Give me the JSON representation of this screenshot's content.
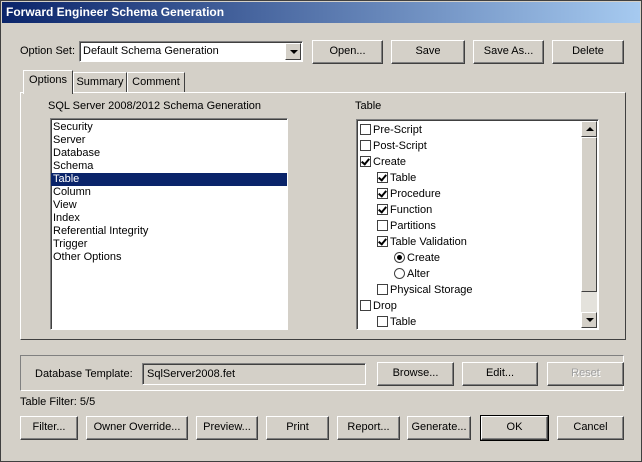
{
  "window": {
    "title": "Forward Engineer Schema Generation"
  },
  "option_set": {
    "label": "Option Set:",
    "value": "Default Schema Generation",
    "buttons": {
      "open": "Open...",
      "save": "Save",
      "save_as": "Save As...",
      "delete": "Delete"
    }
  },
  "tabs": [
    {
      "label": "Options",
      "active": true
    },
    {
      "label": "Summary",
      "active": false
    },
    {
      "label": "Comment",
      "active": false
    }
  ],
  "left_list": {
    "title": "SQL Server 2008/2012 Schema Generation",
    "items": [
      "Security",
      "Server",
      "Database",
      "Schema",
      "Table",
      "Column",
      "View",
      "Index",
      "Referential Integrity",
      "Trigger",
      "Other Options"
    ],
    "selected": "Table"
  },
  "right_list": {
    "title": "Table",
    "items": [
      {
        "label": "Pre-Script",
        "type": "checkbox",
        "checked": false,
        "indent": 0
      },
      {
        "label": "Post-Script",
        "type": "checkbox",
        "checked": false,
        "indent": 0
      },
      {
        "label": "Create",
        "type": "checkbox",
        "checked": true,
        "indent": 0
      },
      {
        "label": "Table",
        "type": "checkbox",
        "checked": true,
        "indent": 1
      },
      {
        "label": "Procedure",
        "type": "checkbox",
        "checked": true,
        "indent": 1
      },
      {
        "label": "Function",
        "type": "checkbox",
        "checked": true,
        "indent": 1
      },
      {
        "label": "Partitions",
        "type": "checkbox",
        "checked": false,
        "indent": 1
      },
      {
        "label": "Table Validation",
        "type": "checkbox",
        "checked": true,
        "indent": 1
      },
      {
        "label": "Create",
        "type": "radio",
        "checked": true,
        "indent": 2
      },
      {
        "label": "Alter",
        "type": "radio",
        "checked": false,
        "indent": 2
      },
      {
        "label": "Physical Storage",
        "type": "checkbox",
        "checked": false,
        "indent": 1
      },
      {
        "label": "Drop",
        "type": "checkbox",
        "checked": false,
        "indent": 0
      },
      {
        "label": "Table",
        "type": "checkbox",
        "checked": false,
        "indent": 1
      }
    ]
  },
  "template": {
    "label": "Database Template:",
    "value": "SqlServer2008.fet",
    "buttons": {
      "browse": "Browse...",
      "edit": "Edit...",
      "reset": "Reset"
    }
  },
  "table_filter": "Table Filter: 5/5",
  "bottom_buttons": {
    "filter": "Filter...",
    "owner_override": "Owner Override...",
    "preview": "Preview...",
    "print": "Print",
    "report": "Report...",
    "generate": "Generate...",
    "ok": "OK",
    "cancel": "Cancel"
  }
}
